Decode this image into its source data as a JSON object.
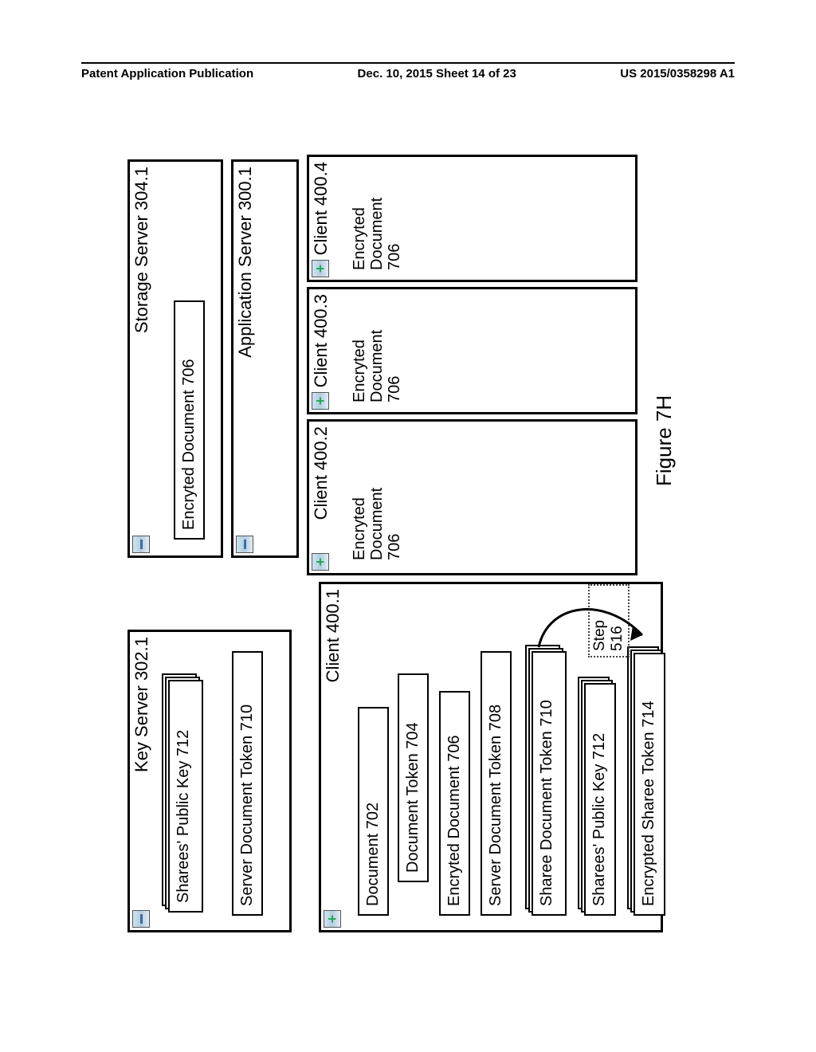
{
  "header": {
    "left": "Patent Application Publication",
    "center": "Dec. 10, 2015  Sheet 14 of 23",
    "right": "US 2015/0358298 A1"
  },
  "figure_caption": "Figure 7H",
  "key_server": {
    "title": "Key Server 302.1",
    "sharees_public_key": "Sharees' Public Key 712",
    "server_doc_token": "Server Document Token 710"
  },
  "storage_server": {
    "title": "Storage Server 304.1",
    "encrypted_doc": "Encryted Document 706"
  },
  "app_server": {
    "title": "Application Server 300.1"
  },
  "client1": {
    "title": "Client 400.1",
    "document": "Document 702",
    "doc_token": "Document Token 704",
    "encrypted_doc": "Encryted Document 706",
    "server_doc_token": "Server Document Token 708",
    "sharee_doc_token": "Sharee Document Token 710",
    "sharees_public_key": "Sharees' Public Key 712",
    "encrypted_sharee_token": "Encrypted Sharee Token 714"
  },
  "client2": {
    "title": "Client 400.2",
    "encrypted_doc_l1": "Encryted",
    "encrypted_doc_l2": "Document",
    "encrypted_doc_l3": "706"
  },
  "client3": {
    "title": "Client 400.3",
    "encrypted_doc_l1": "Encryted",
    "encrypted_doc_l2": "Document",
    "encrypted_doc_l3": "706"
  },
  "client4": {
    "title": "Client 400.4",
    "encrypted_doc_l1": "Encryted",
    "encrypted_doc_l2": "Document",
    "encrypted_doc_l3": "706"
  },
  "step": "Step 516"
}
